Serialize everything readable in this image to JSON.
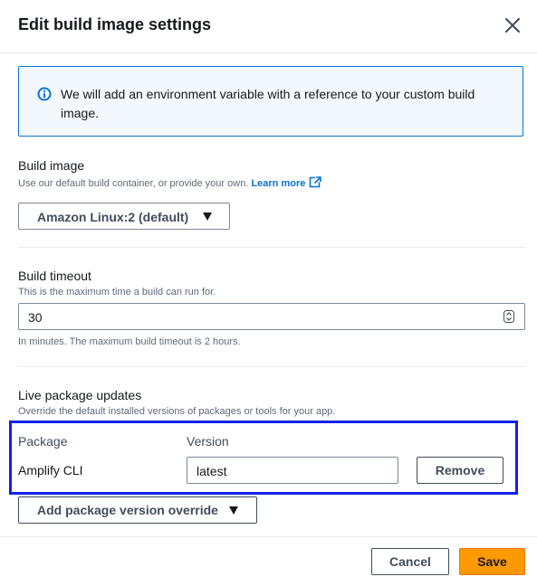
{
  "modal": {
    "title": "Edit build image settings"
  },
  "alert": {
    "text": "We will add an environment variable with a reference to your custom build image."
  },
  "build_image": {
    "label": "Build image",
    "description": "Use our default build container, or provide your own.",
    "link_text": "Learn more",
    "selected": "Amazon Linux:2 (default)"
  },
  "build_timeout": {
    "label": "Build timeout",
    "description": "This is the maximum time a build can run for.",
    "value": "30",
    "hint": "In minutes. The maximum build timeout is 2 hours."
  },
  "live_updates": {
    "label": "Live package updates",
    "description": "Override the default installed versions of packages or tools for your app.",
    "columns": [
      "Package",
      "Version"
    ],
    "rows": [
      {
        "package": "Amplify CLI",
        "version": "latest",
        "remove_label": "Remove"
      }
    ],
    "add_label": "Add package version override"
  },
  "footer": {
    "cancel_label": "Cancel",
    "save_label": "Save"
  },
  "colors": {
    "accent": "#0972d3",
    "primary_button": "#ff9900",
    "highlight_border": "#1322e6",
    "alert_background": "#f2f8fd"
  },
  "icons": [
    "close-icon",
    "info-icon",
    "external-link-icon",
    "caret-down-icon",
    "spinner-icon"
  ]
}
